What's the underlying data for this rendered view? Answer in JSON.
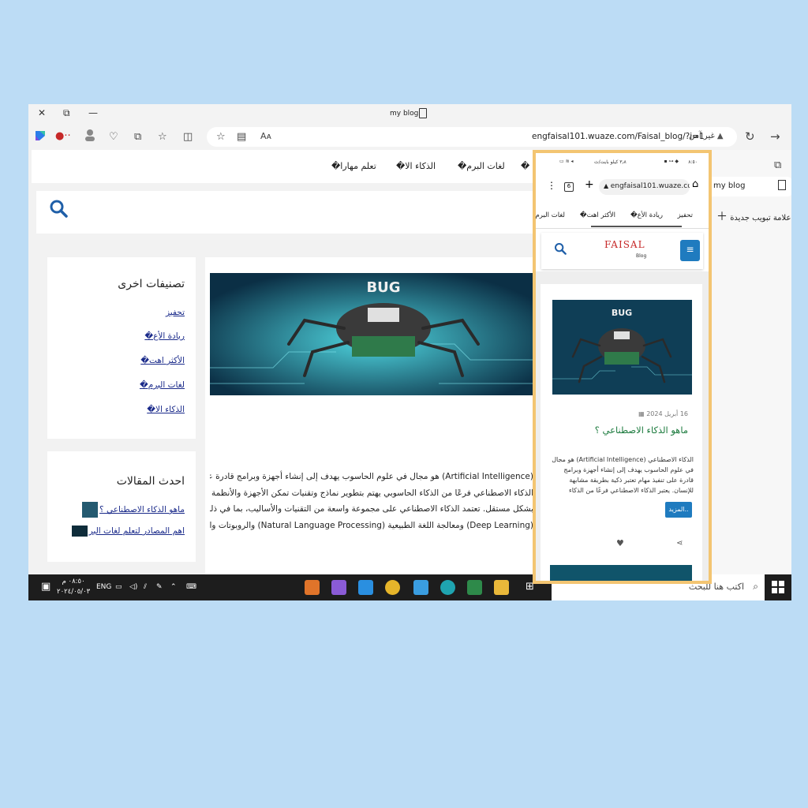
{
  "window": {
    "title": "my blog",
    "close": "✕",
    "restore": "⧉",
    "minimize": "—"
  },
  "address": {
    "url": "engfaisal101.wuaze.com/Faisal_blog/?i=1",
    "insecure_label": "غير آمن",
    "reader": "Aᴀ"
  },
  "site_nav": [
    "تعلم مهارا�",
    "الذكاء الا�",
    "لغات البرم�",
    "�"
  ],
  "sidebar": {
    "categories_title": "تصنيفات اخرى",
    "categories": [
      "تحفيز",
      "ريادة الأع�",
      "الأكثر اهت�",
      "لغات البرم�",
      "الذكاء الا�"
    ],
    "recent_title": "احدث المقالات",
    "recent_posts": [
      "ماهو الذكاء الاصطناعي ؟",
      "اهم المصادر لتعلم لغات البر"
    ]
  },
  "article": {
    "image_label": "BUG",
    "lines": [
      "(Artificial Intelligence) هو مجال في علوم الحاسوب يهدف إلى إنشاء أجهزة وبرامج قادرة على تنفيذ مهام تعتبر ذكية",
      "الذكاء الاصطناعي فرعًا من الذكاء الحاسوبي يهتم بتطوير نماذج وتقنيات تمكن الأجهزة والأنظمة من",
      "بشكل مستقل. تعتمد الذكاء الاصطناعي على مجموعة واسعة من التقنيات والأساليب، بما في ذلك تعلم",
      "(Deep Learning) ومعالجة اللغة الطبيعية (Natural Language Processing) والروبوتات والمنطق،"
    ]
  },
  "right_panel": {
    "tab_title": "my blog",
    "new_tab": "علامة تبويب جديدة"
  },
  "phone": {
    "status_left": "٨:٥٠",
    "status_right": "٣٫٨ كيلو بايت/ث",
    "url": "engfaisal101.wuaze.com",
    "tab_count": "6",
    "nav": [
      "تحفيز",
      "ريادة الأع�",
      "الأكثر اهت�",
      "لغات البرم�"
    ],
    "logo": "FAISAL",
    "logo_sub": "Blog",
    "image_label": "BUG",
    "date": "16 أبريل 2024",
    "title": "ماهو الذكاء الاصطناعي ؟",
    "excerpt": "الذكاء الاصطناعي (Artificial Intelligence) هو مجال في علوم الحاسوب يهدف إلى إنشاء أجهزة وبرامج قادرة على تنفيذ مهام تعتبر ذكية بطريقة مشابهة للإنسان. يعتبر الذكاء الاصطناعي فرعًا من الذكاء الحاسوبي يهتم",
    "more": "المزيد.."
  },
  "taskbar": {
    "search_placeholder": "اكتب هنا للبحث",
    "lang": "ENG",
    "time": "٠٨:٥٠ م",
    "date": "٢٠٢٤/٠٥/٠٣"
  },
  "colors": {
    "accent_link": "#1a2a8a",
    "phone_border": "#f3c572",
    "title_green": "#1b7a3d",
    "button_blue": "#1f7bbf"
  }
}
